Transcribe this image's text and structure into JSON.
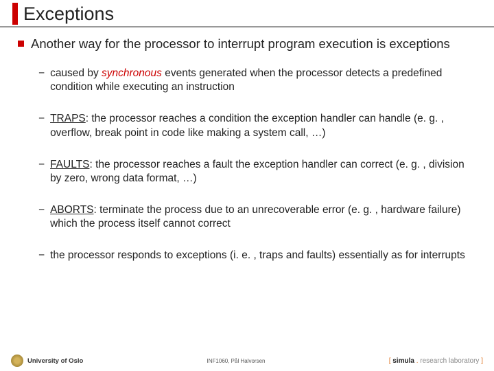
{
  "title": "Exceptions",
  "main_bullet": "Another way for the processor to interrupt program execution is exceptions",
  "items": [
    {
      "pre": "caused by ",
      "em": "synchronous",
      "post": " events generated when the processor detects a predefined condition while executing an instruction"
    },
    {
      "label": "TRAPS",
      "body": ": the processor reaches a condition the exception handler can handle (e. g. , overflow, break point in code like making a system call, …)"
    },
    {
      "label": "FAULTS",
      "body": ": the processor reaches a fault the exception handler can correct (e. g. , division by zero, wrong data format, …)"
    },
    {
      "label": "ABORTS",
      "body": ": terminate the process due to an unrecoverable error (e. g. , hardware failure) which the process itself cannot correct"
    },
    {
      "plain": "the processor responds to exceptions (i. e. , traps and faults) essentially as for interrupts"
    }
  ],
  "footer": {
    "left": "University of Oslo",
    "mid": "INF1060, Pål Halvorsen",
    "right_open": "[ ",
    "right_brand": "simula",
    "right_dot": " . ",
    "right_lab": "research laboratory",
    "right_close": " ]"
  }
}
